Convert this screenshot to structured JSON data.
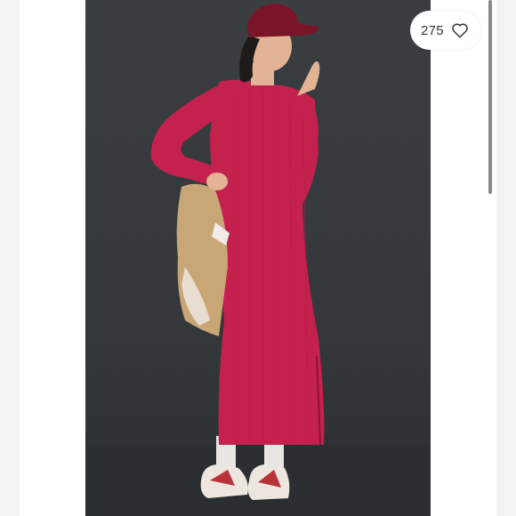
{
  "listing": {
    "like_count": "275",
    "like_icon": "heart-outline-icon"
  },
  "colors": {
    "backdrop": "#363a3d",
    "dress": "#c5214e",
    "cap": "#7a1428",
    "jacket": "#c9a676"
  }
}
